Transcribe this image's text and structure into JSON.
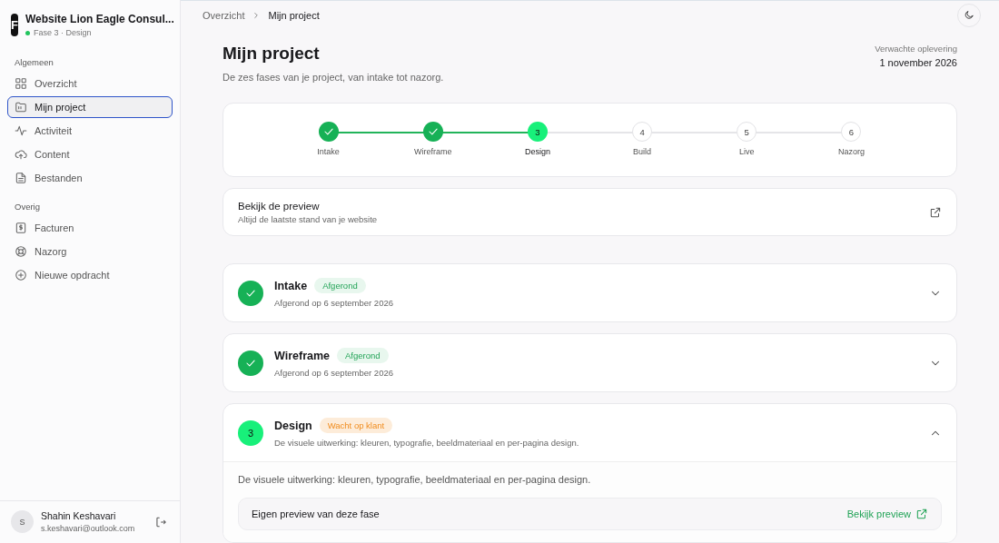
{
  "project": {
    "logo": "F",
    "name": "Website Lion Eagle Consul...",
    "status": "Fase 3 · Design"
  },
  "sidebar": {
    "sections": [
      {
        "title": "Algemeen",
        "items": [
          {
            "label": "Overzicht",
            "selected": false
          },
          {
            "label": "Mijn project",
            "selected": true
          },
          {
            "label": "Activiteit",
            "selected": false
          },
          {
            "label": "Content",
            "selected": false
          },
          {
            "label": "Bestanden",
            "selected": false
          }
        ]
      },
      {
        "title": "Overig",
        "items": [
          {
            "label": "Facturen",
            "selected": false
          },
          {
            "label": "Nazorg",
            "selected": false
          },
          {
            "label": "Nieuwe opdracht",
            "selected": false
          }
        ]
      }
    ]
  },
  "user": {
    "initial": "S",
    "name": "Shahin Keshavari",
    "email": "s.keshavari@outlook.com"
  },
  "breadcrumb": [
    "Overzicht",
    "Mijn project"
  ],
  "page": {
    "title": "Mijn project",
    "subtitle": "De zes fases van je project, van intake tot nazorg.",
    "delivery_label": "Verwachte oplevering",
    "delivery_date": "1 november 2026"
  },
  "steps": [
    {
      "label": "Intake",
      "completed": true,
      "current": false
    },
    {
      "label": "Wireframe",
      "completed": true,
      "current": false
    },
    {
      "number": "3",
      "label": "Design",
      "completed": false,
      "current": true
    },
    {
      "number": "4",
      "label": "Build",
      "completed": false,
      "current": false
    },
    {
      "number": "5",
      "label": "Live",
      "completed": false,
      "current": false
    },
    {
      "number": "6",
      "label": "Nazorg",
      "completed": false,
      "current": false
    }
  ],
  "preview_card": {
    "title": "Bekijk de preview",
    "subtitle": "Altijd de laatste stand van je website"
  },
  "phases": [
    {
      "title": "Intake",
      "completed": true,
      "badge": "Afgerond",
      "subtitle": "Afgerond op 6 september 2026",
      "expanded": false
    },
    {
      "title": "Wireframe",
      "completed": true,
      "badge": "Afgerond",
      "subtitle": "Afgerond op 6 september 2026",
      "expanded": false
    },
    {
      "number": "3",
      "title": "Design",
      "completed": false,
      "badge": "Wacht op klant",
      "subtitle": "De visuele uitwerking: kleuren, typografie, beeldmateriaal en per-pagina design.",
      "expanded": true,
      "description": "De visuele uitwerking: kleuren, typografie, beeldmateriaal en per-pagina design.",
      "preview_label": "Eigen preview van deze fase",
      "preview_link": "Bekijk preview"
    }
  ]
}
